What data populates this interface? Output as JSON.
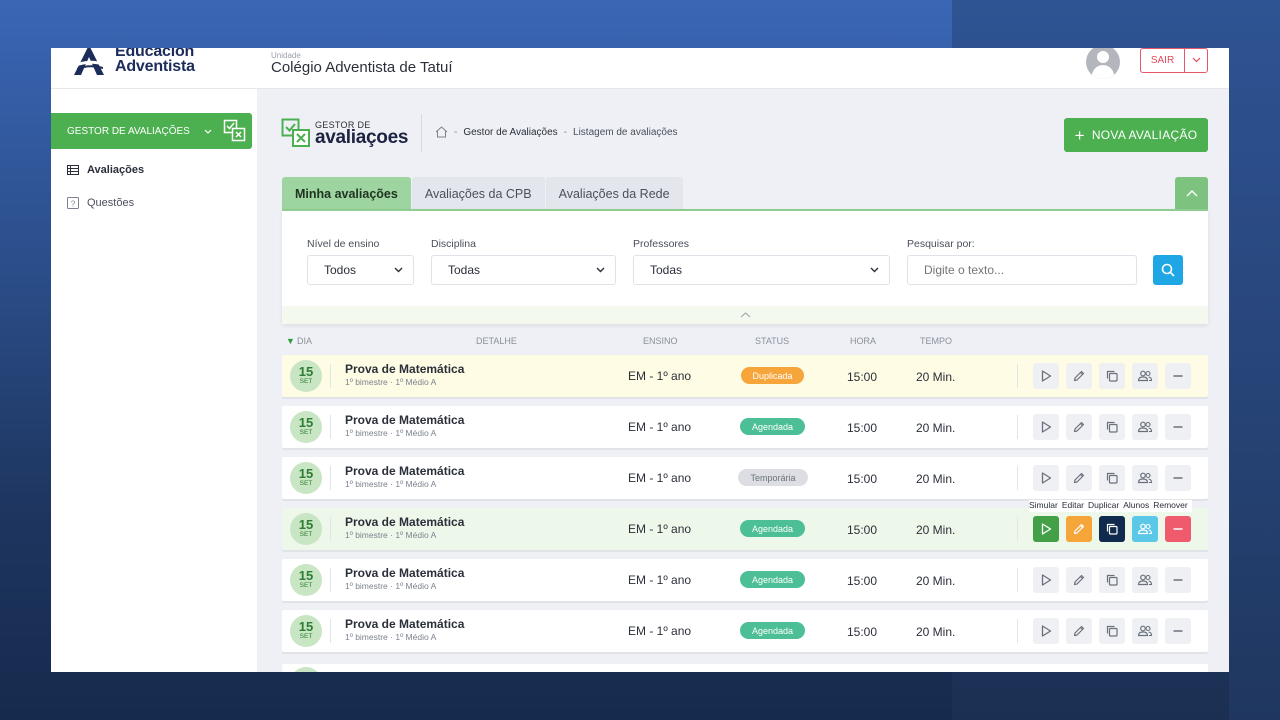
{
  "header": {
    "logo_line1": "Educación",
    "logo_line2": "Adventista",
    "unit_label": "Unidade",
    "unit_name": "Colégio Adventista de Tatuí",
    "logout_label": "SAIR"
  },
  "sidebar": {
    "module_label": "GESTOR DE AVALIAÇÕES",
    "items": [
      {
        "label": "Avaliações",
        "icon": "table-icon",
        "active": true
      },
      {
        "label": "Questões",
        "icon": "question-icon",
        "active": false
      }
    ]
  },
  "page": {
    "brand_small": "GESTOR DE",
    "brand_big": "avaliaçoes",
    "breadcrumb": [
      "Gestor de Avaliações",
      "Listagem de avaliações"
    ],
    "new_button": "NOVA AVALIAÇÃO"
  },
  "tabs": [
    "Minha avaliações",
    "Avaliações da CPB",
    "Avaliações da Rede"
  ],
  "filters": {
    "nivel": {
      "label": "Nível de ensino",
      "value": "Todos"
    },
    "disciplina": {
      "label": "Disciplina",
      "value": "Todas"
    },
    "professores": {
      "label": "Professores",
      "value": "Todas"
    },
    "pesquisa": {
      "label": "Pesquisar por:",
      "placeholder": "Digite o texto..."
    }
  },
  "table": {
    "columns": [
      "DIA",
      "DETALHE",
      "ENSINO",
      "STATUS",
      "HORA",
      "TEMPO"
    ],
    "rows": [
      {
        "day": "15",
        "month": "SET",
        "title": "Prova de Matemática",
        "subtitle": "1º bimestre · 1º Médio A",
        "ensino": "EM - 1º ano",
        "status": "Duplicada",
        "hora": "15:00",
        "tempo": "20 Min."
      },
      {
        "day": "15",
        "month": "SET",
        "title": "Prova de Matemática",
        "subtitle": "1º bimestre · 1º Médio A",
        "ensino": "EM - 1º ano",
        "status": "Agendada",
        "hora": "15:00",
        "tempo": "20 Min."
      },
      {
        "day": "15",
        "month": "SET",
        "title": "Prova de Matemática",
        "subtitle": "1º bimestre · 1º Médio A",
        "ensino": "EM - 1º ano",
        "status": "Temporária",
        "hora": "15:00",
        "tempo": "20 Min."
      },
      {
        "day": "15",
        "month": "SET",
        "title": "Prova de Matemática",
        "subtitle": "1º bimestre · 1º Médio A",
        "ensino": "EM - 1º ano",
        "status": "Agendada",
        "hora": "15:00",
        "tempo": "20 Min."
      },
      {
        "day": "15",
        "month": "SET",
        "title": "Prova de Matemática",
        "subtitle": "1º bimestre · 1º Médio A",
        "ensino": "EM - 1º ano",
        "status": "Agendada",
        "hora": "15:00",
        "tempo": "20 Min."
      },
      {
        "day": "15",
        "month": "SET",
        "title": "Prova de Matemática",
        "subtitle": "1º bimestre · 1º Médio A",
        "ensino": "EM - 1º ano",
        "status": "Agendada",
        "hora": "15:00",
        "tempo": "20 Min."
      }
    ]
  },
  "actions": {
    "tooltips": [
      "Simular",
      "Editar",
      "Duplicar",
      "Alunos",
      "Remover"
    ]
  },
  "colors": {
    "brand_green": "#4caf50",
    "status_duplicada": "#f6a53a",
    "status_agendada": "#4cbf96",
    "status_temporaria": "#dcdee3",
    "action_simular": "#43a047",
    "action_editar": "#f6a53a",
    "action_duplicar": "#0f2a4d",
    "action_alunos": "#5ac8e6",
    "action_remover": "#ef5a6c",
    "search_button": "#1ea7e4"
  }
}
